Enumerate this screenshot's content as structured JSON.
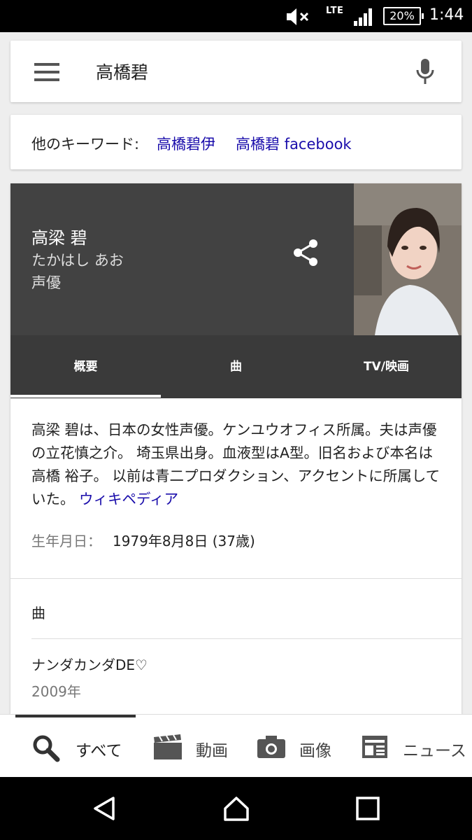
{
  "status_bar": {
    "network": "LTE",
    "battery": "20%",
    "time": "1:44",
    "icons": [
      "mute-icon",
      "signal-icon",
      "battery-icon"
    ]
  },
  "search": {
    "query": "高橋碧"
  },
  "related": {
    "label": "他のキーワード:",
    "links": [
      "高橋碧伊",
      "高橋碧 facebook"
    ]
  },
  "knowledge_panel": {
    "name": "高梁 碧",
    "reading": "たかはし あお",
    "role": "声優",
    "tabs": [
      "概要",
      "曲",
      "TV/映画"
    ],
    "description": "高梁 碧は、日本の女性声優。ケンユウオフィス所属。夫は声優の立花慎之介。 埼玉県出身。血液型はA型。旧名および本名は高橋 裕子。 以前は青二プロダクション、アクセントに所属していた。",
    "wiki_link": "ウィキペディア",
    "birth_label": "生年月日：",
    "birth_value": "1979年8月8日 (37歳)",
    "songs_heading": "曲",
    "songs": [
      {
        "title": "ナンダカンダDE♡",
        "year": "2009年"
      }
    ]
  },
  "bottom_tabs": [
    {
      "label": "すべて",
      "icon": "search-icon"
    },
    {
      "label": "動画",
      "icon": "video-icon"
    },
    {
      "label": "画像",
      "icon": "camera-icon"
    },
    {
      "label": "ニュース",
      "icon": "news-icon"
    }
  ],
  "colors": {
    "link": "#1a0dab",
    "header_bg": "#424242",
    "tabs_bg": "#3a3a3a"
  }
}
